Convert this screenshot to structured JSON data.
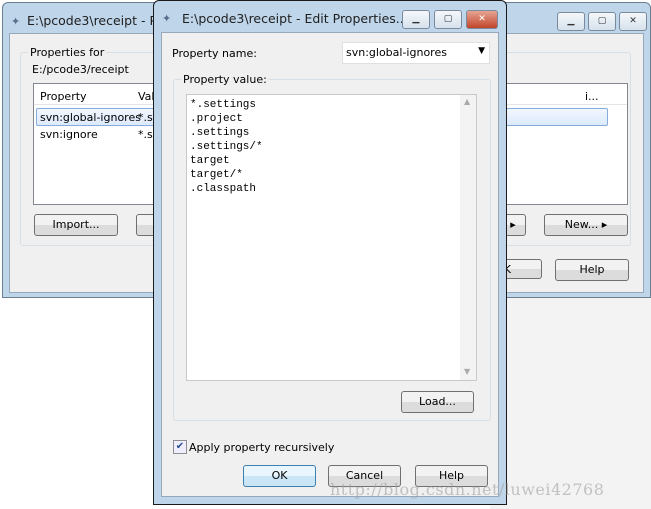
{
  "background_window": {
    "title": "E:\\pcode3\\receipt - P",
    "group_label": "Properties for",
    "path": "E:/pcode3/receipt",
    "columns": [
      "Property",
      "Valu",
      "i..."
    ],
    "rows": [
      {
        "name": "svn:global-ignores",
        "value": "*.se"
      },
      {
        "name": "svn:ignore",
        "value": "*.se"
      }
    ],
    "buttons": {
      "import": "Import...",
      "new": "New...",
      "ok": "K",
      "help": "Help"
    }
  },
  "dialog": {
    "title": "E:\\pcode3\\receipt - Edit Properties...",
    "property_name_label": "Property name:",
    "property_name_value": "svn:global-ignores",
    "property_value_label": "Property value:",
    "property_value_lines": [
      "*.settings",
      ".project",
      ".settings",
      ".settings/*",
      "target",
      "target/*",
      ".classpath"
    ],
    "load": "Load...",
    "recursive_label": "Apply property recursively",
    "recursive_checked": true,
    "ok": "OK",
    "cancel": "Cancel",
    "help": "Help"
  },
  "watermark": "http://blog.csdn.net/luwei42768"
}
